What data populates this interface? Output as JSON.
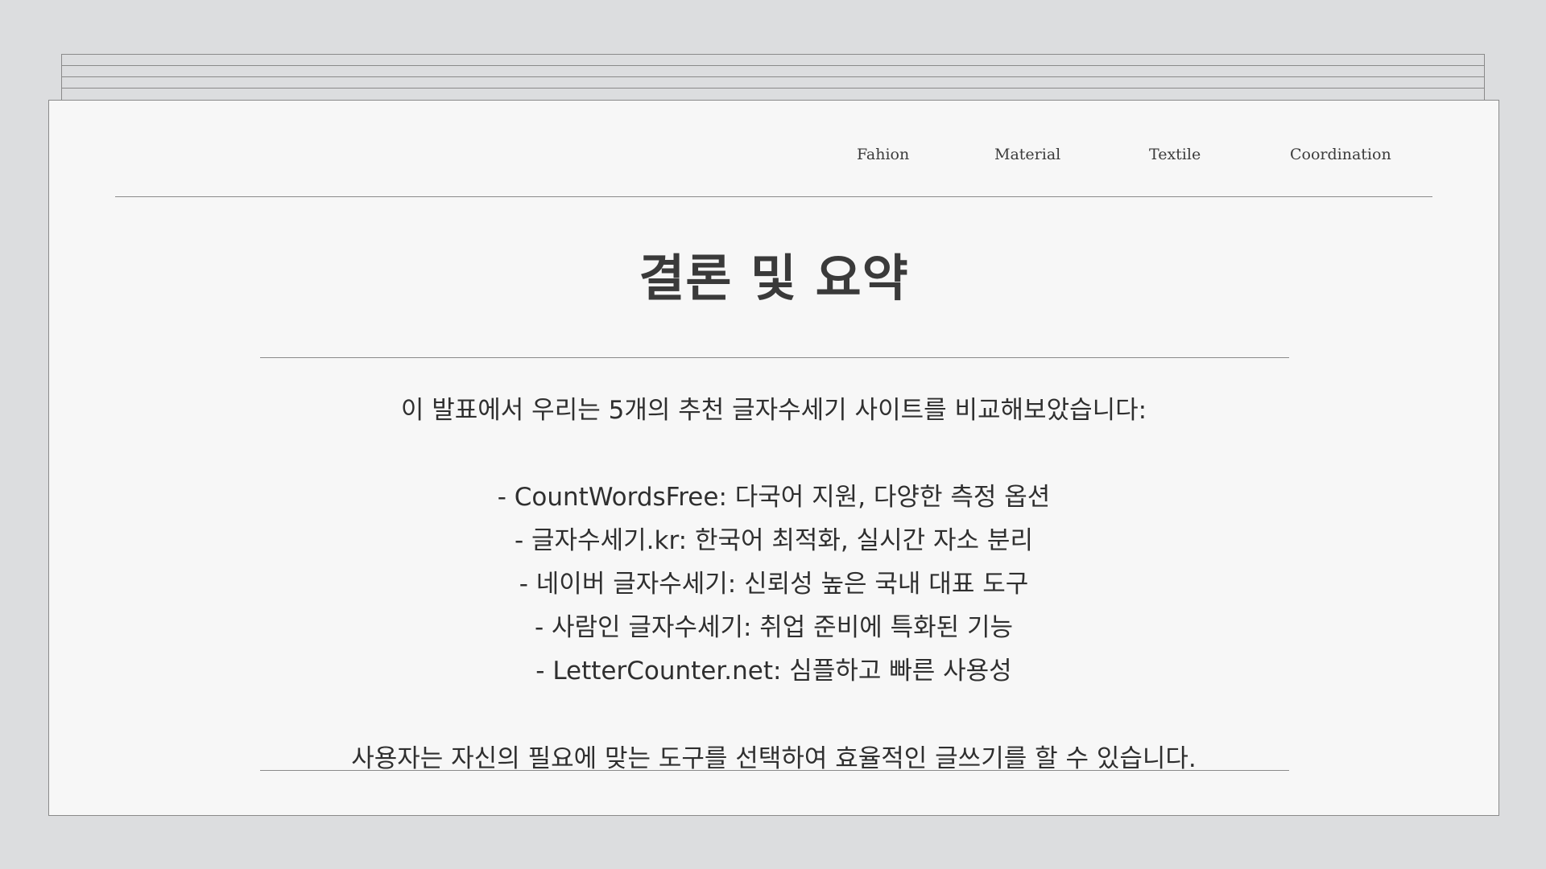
{
  "nav": {
    "items": [
      {
        "label": "Fahion"
      },
      {
        "label": "Material"
      },
      {
        "label": "Textile"
      },
      {
        "label": "Coordination"
      }
    ]
  },
  "slide": {
    "title": "결론 및 요약",
    "intro": "이 발표에서 우리는 5개의 추천 글자수세기 사이트를 비교해보았습니다:",
    "bullets": [
      "- CountWordsFree: 다국어 지원, 다양한 측정 옵션",
      "- 글자수세기.kr: 한국어 최적화, 실시간 자소 분리",
      "- 네이버 글자수세기: 신뢰성 높은 국내 대표 도구",
      "- 사람인 글자수세기: 취업 준비에 특화된 기능",
      "- LetterCounter.net: 심플하고 빠른 사용성"
    ],
    "closing": "사용자는 자신의 필요에 맞는 도구를 선택하여 효율적인 글쓰기를 할 수 있습니다."
  },
  "colors": {
    "background": "#dcdddf",
    "panel": "#f7f7f7",
    "rule": "#8a8a8a",
    "text": "#2f2f2f"
  }
}
